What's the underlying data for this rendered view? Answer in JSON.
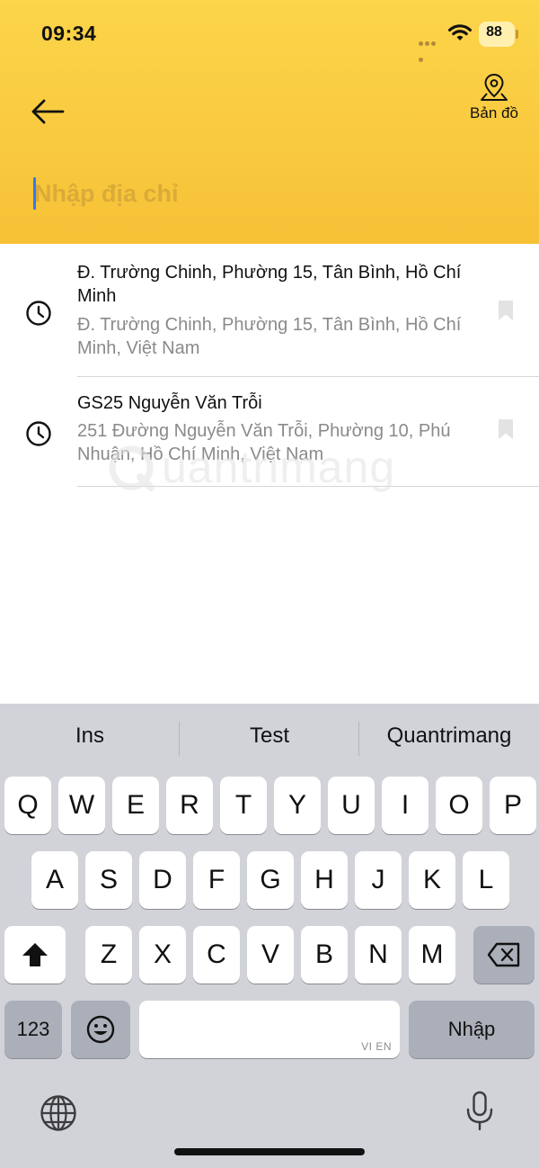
{
  "status_bar": {
    "time": "09:34",
    "battery": "88"
  },
  "header": {
    "back_icon": "arrow-left-icon",
    "map_icon": "map-pin-icon",
    "map_label": "Bản đồ",
    "address_placeholder": "Nhập địa chỉ",
    "address_value": ""
  },
  "recent": [
    {
      "title": "Đ. Trường Chinh, Phường 15, Tân Bình, Hồ Chí Minh",
      "subtitle": "Đ. Trường Chinh, Phường 15, Tân Bình, Hồ Chí Minh, Việt Nam",
      "icon": "clock-icon",
      "action_icon": "bookmark-icon"
    },
    {
      "title": "GS25 Nguyễn Văn Trỗi",
      "subtitle": "251 Đường Nguyễn Văn Trỗi, Phường 10, Phú Nhuận, Hồ Chí Minh, Việt Nam",
      "icon": "clock-icon",
      "action_icon": "bookmark-icon"
    }
  ],
  "watermark": "uantrimang",
  "keyboard": {
    "suggestions": [
      "Ins",
      "Test",
      "Quantrimang"
    ],
    "row1": [
      "Q",
      "W",
      "E",
      "R",
      "T",
      "Y",
      "U",
      "I",
      "O",
      "P"
    ],
    "row2": [
      "A",
      "S",
      "D",
      "F",
      "G",
      "H",
      "J",
      "K",
      "L"
    ],
    "row3": [
      "Z",
      "X",
      "C",
      "V",
      "B",
      "N",
      "M"
    ],
    "numbers_key": "123",
    "space_hint": "VI EN",
    "return_key": "Nhập",
    "shift_icon": "shift-icon",
    "delete_icon": "backspace-icon",
    "emoji_icon": "emoji-icon",
    "globe_icon": "globe-icon",
    "mic_icon": "microphone-icon"
  },
  "colors": {
    "header_bg": "#f9c83e",
    "placeholder": "#d9ab39",
    "caret": "#3478f6",
    "keyboard_bg": "#d1d3d9"
  }
}
